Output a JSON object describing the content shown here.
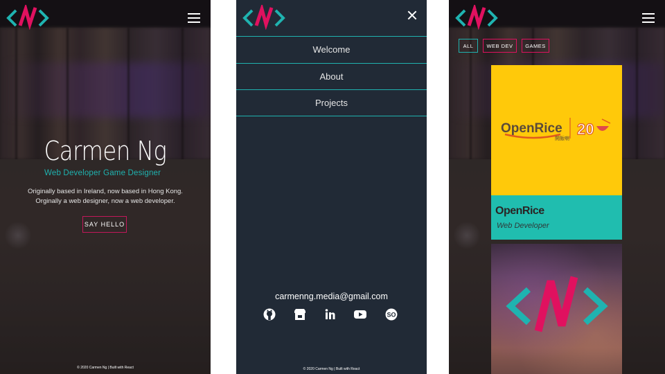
{
  "brand": {
    "logo_alt": "NN",
    "colors": {
      "teal": "#1fb3b0",
      "pink": "#e0115f",
      "dark": "#212a36",
      "yellow": "#ffc90a",
      "card_teal": "#20bdaf"
    }
  },
  "welcome": {
    "name": "Carmen Ng",
    "role": "Web Developer  Game Designer",
    "description_line1": "Originally based in Ireland, now based in Hong Kong.",
    "description_line2": "Orginally a web designer, now a web developer.",
    "cta": "SAY HELLO",
    "footer": "© 2020 Carmen Ng | Built with React"
  },
  "menu": {
    "items": [
      {
        "label": "Welcome"
      },
      {
        "label": "About"
      },
      {
        "label": "Projects"
      }
    ],
    "email": "carmenng.media@gmail.com",
    "socials": [
      "github-icon",
      "itch-store-icon",
      "linkedin-icon",
      "youtube-icon",
      "stackoverflow-icon"
    ],
    "footer": "© 2020 Carmen Ng | Built with React"
  },
  "projects": {
    "filters": [
      {
        "label": "ALL",
        "color": "#1fb3b0",
        "active": true
      },
      {
        "label": "WEB DEV",
        "color": "#e0115f",
        "active": false
      },
      {
        "label": "GAMES",
        "color": "#e0115f",
        "active": false
      }
    ],
    "cards": [
      {
        "title": "OpenRice",
        "role": "Web Developer",
        "logo_text": "OpenRice",
        "logo_chinese": "開飯喇",
        "logo_number": "20"
      }
    ]
  }
}
